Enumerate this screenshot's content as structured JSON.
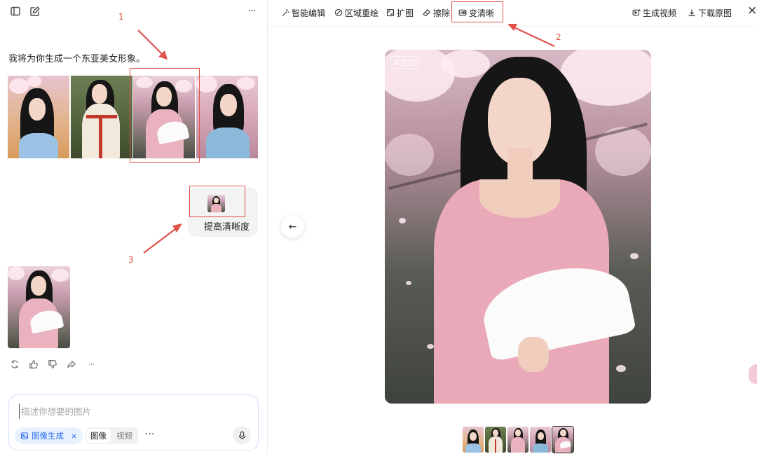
{
  "sidebar": {
    "toggle_icon": "sidebar-toggle-icon",
    "new_chat_icon": "edit-icon",
    "more_icon": "more-horizontal-icon"
  },
  "chat": {
    "assistant_message": "我将为你生成一个东亚美女形象。",
    "user_message": "提高清晰度",
    "result_actions": [
      "refresh-icon",
      "thumbs-up-icon",
      "thumbs-down-icon",
      "share-icon",
      "more-horizontal-icon"
    ]
  },
  "annotations": {
    "n1": "1",
    "n2": "2",
    "n3": "3",
    "color": "#e0524a"
  },
  "composer": {
    "placeholder": "描述你想要的图片",
    "mode_chip": "图像生成",
    "mode_close": "×",
    "segment_image": "图像",
    "segment_video": "视频",
    "more": "···"
  },
  "toolbar": {
    "smart_edit": "智能编辑",
    "region_repaint": "区域重绘",
    "expand": "扩图",
    "erase": "擦除",
    "sharpen": "变清晰",
    "make_video": "生成视频",
    "download": "下载原图",
    "close": "×"
  },
  "viewer": {
    "ai_badge": "AI生成",
    "prev_icon": "←"
  },
  "colors": {
    "accent": "#2a6ff1",
    "highlight": "#e0524a",
    "chip_bg": "#e9f1ff"
  }
}
